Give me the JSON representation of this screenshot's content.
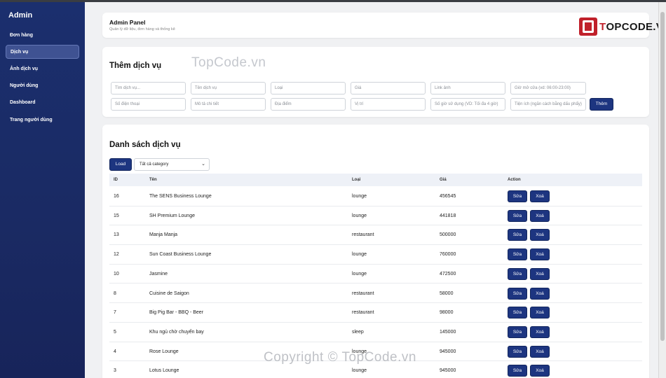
{
  "sidebar": {
    "brand": "Admin",
    "items": [
      {
        "label": "Đơn hàng",
        "active": false
      },
      {
        "label": "Dịch vụ",
        "active": true
      },
      {
        "label": "Ảnh dịch vụ",
        "active": false
      },
      {
        "label": "Người dùng",
        "active": false
      },
      {
        "label": "Dashboard",
        "active": false
      },
      {
        "label": "Trang người dùng",
        "active": false
      }
    ]
  },
  "header": {
    "title": "Admin Panel",
    "subtitle": "Quản lý dữ liệu, đơn hàng và thống kê",
    "logo_text_accent": "T",
    "logo_text": "OPCODE.VN"
  },
  "add_form": {
    "title": "Thêm dịch vụ",
    "watermark": "TopCode.vn",
    "fields_row1": [
      "Tìm dịch vụ...",
      "Tên dịch vụ",
      "Loại",
      "Giá",
      "Link ảnh",
      "Giờ mở cửa (vd: 06:00-23:00)"
    ],
    "fields_row2": [
      "Số điện thoại",
      "Mô tả chi tiết",
      "Địa điểm",
      "Vị trí",
      "Số giờ sử dụng (VD: Tối đa 4 giờ)",
      "Tiện ích (ngăn cách bằng dấu phẩy)"
    ],
    "submit_label": "Thêm"
  },
  "list": {
    "title": "Danh sách dịch vụ",
    "load_label": "Load",
    "category_select": "Tất cả category",
    "columns": [
      "ID",
      "Tên",
      "Loại",
      "Giá",
      "Action"
    ],
    "edit_label": "Sửa",
    "delete_label": "Xoá",
    "rows": [
      {
        "id": "16",
        "name": "The SENS Business Lounge",
        "type": "lounge",
        "price": "456545"
      },
      {
        "id": "15",
        "name": "SH Premium Lounge",
        "type": "lounge",
        "price": "441818"
      },
      {
        "id": "13",
        "name": "Manja Manja",
        "type": "restaurant",
        "price": "500000"
      },
      {
        "id": "12",
        "name": "Sun Coast Business Lounge",
        "type": "lounge",
        "price": "760000"
      },
      {
        "id": "10",
        "name": "Jasmine",
        "type": "lounge",
        "price": "472500"
      },
      {
        "id": "8",
        "name": "Cuisine de Saigon",
        "type": "restaurant",
        "price": "58000"
      },
      {
        "id": "7",
        "name": "Big Pig Bar - BBQ - Beer",
        "type": "restaurant",
        "price": "98000"
      },
      {
        "id": "5",
        "name": "Khu ngủ chờ chuyến bay",
        "type": "sleep",
        "price": "145000"
      },
      {
        "id": "4",
        "name": "Rose Lounge",
        "type": "lounge",
        "price": "945000"
      },
      {
        "id": "3",
        "name": "Lotus Lounge",
        "type": "lounge",
        "price": "945000"
      }
    ],
    "watermark": "Copyright © TopCode.vn"
  }
}
